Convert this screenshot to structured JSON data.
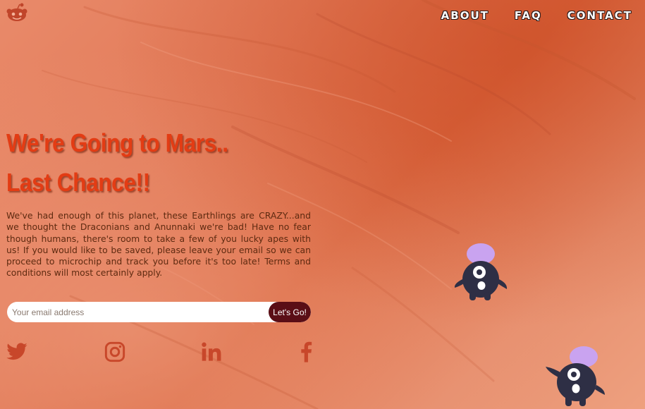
{
  "nav": {
    "items": [
      "ABOUT",
      "FAQ",
      "CONTACT"
    ]
  },
  "hero": {
    "title_line1": "We're Going to Mars..",
    "title_line2": "Last Chance!!",
    "description": "We've had enough of this planet, these Earthlings are CRAZY...and we thought the Draconians and Anunnaki we're bad! Have no fear though humans, there's room to take a few of you lucky apes with us! If you would like to be saved, please leave your email so we can proceed to microchip and track you before it's too late! Terms and conditions will most certainly apply."
  },
  "signup": {
    "placeholder": "Your email address",
    "button_label": "Let's Go!"
  },
  "social": [
    "twitter-icon",
    "instagram-icon",
    "linkedin-icon",
    "facebook-icon"
  ],
  "colors": {
    "title": "#e33c14",
    "button": "#5a0e16",
    "text": "#5e2a10",
    "creature_body": "#2e2f45",
    "creature_hat": "#c9a3f0"
  }
}
